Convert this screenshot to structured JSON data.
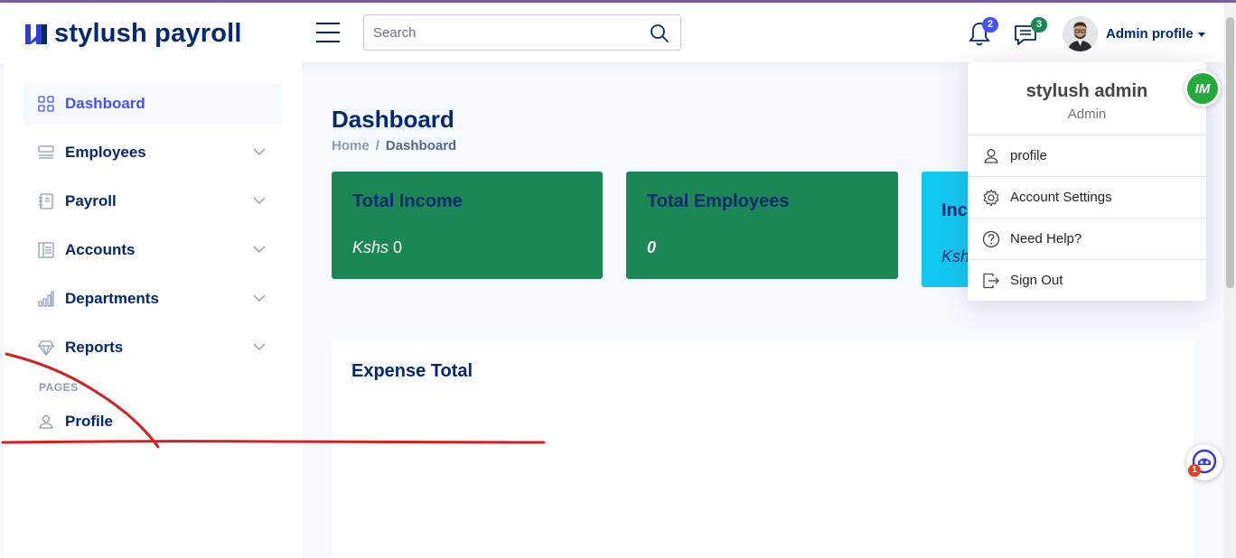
{
  "header": {
    "app_name": "stylush payroll",
    "search_placeholder": "Search",
    "notifications_count": "2",
    "messages_count": "3",
    "profile_label": "Admin profile"
  },
  "sidebar": {
    "items": [
      {
        "label": "Dashboard",
        "icon": "grid-icon",
        "active": true
      },
      {
        "label": "Employees",
        "icon": "menu-button-icon"
      },
      {
        "label": "Payroll",
        "icon": "journal-text-icon"
      },
      {
        "label": "Accounts",
        "icon": "layout-text-icon"
      },
      {
        "label": "Departments",
        "icon": "bar-chart-icon"
      },
      {
        "label": "Reports",
        "icon": "gem-icon"
      }
    ],
    "pages_heading": "PAGES",
    "profile_item": "Profile"
  },
  "main": {
    "title": "Dashboard",
    "breadcrumb": {
      "home": "Home",
      "separator": "/",
      "current": "Dashboard"
    },
    "cards": [
      {
        "title": "Total Income",
        "currency": "Kshs",
        "value": "0",
        "color": "#1a8754"
      },
      {
        "title": "Total Employees",
        "value": "0",
        "color": "#1a8754"
      },
      {
        "title": "Inc",
        "currency": "Ksh",
        "color": "#13c8f0"
      }
    ],
    "expense_title": "Expense Total"
  },
  "dropdown": {
    "name": "stylush admin",
    "role": "Admin",
    "items": [
      {
        "label": "profile",
        "icon": "person-icon"
      },
      {
        "label": "Account Settings",
        "icon": "gear-icon"
      },
      {
        "label": "Need Help?",
        "icon": "question-circle-icon"
      },
      {
        "label": "Sign Out",
        "icon": "box-arrow-right-icon"
      }
    ]
  },
  "widgets": {
    "im_label": "IM",
    "bot_count": "1"
  },
  "colors": {
    "primary": "#012970",
    "accent": "#4154f1",
    "card_green": "#1a8754",
    "card_cyan": "#13c8f0",
    "annotation_red": "#d42020"
  }
}
